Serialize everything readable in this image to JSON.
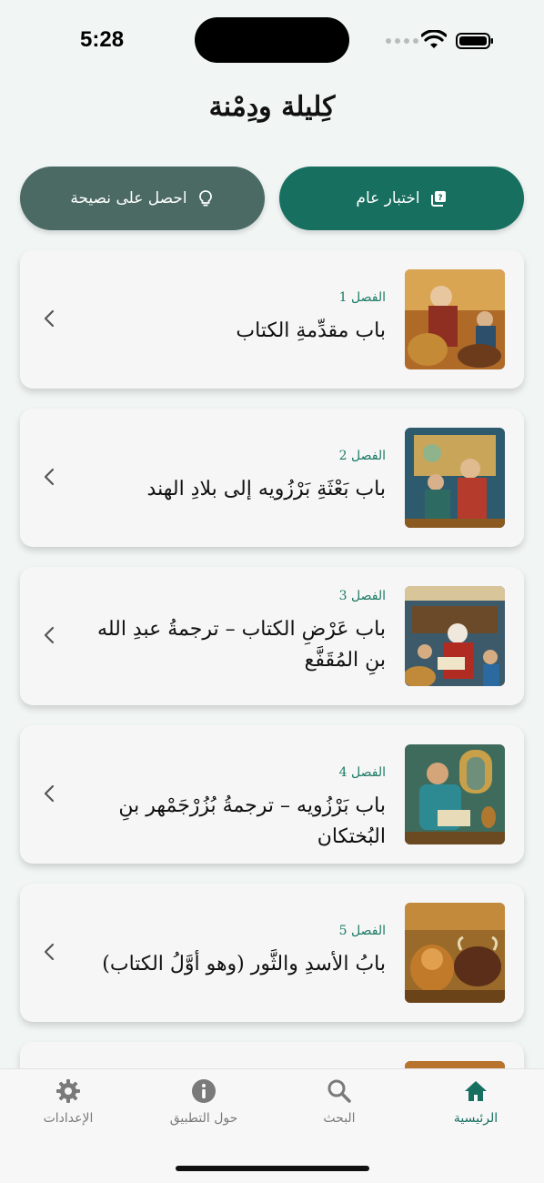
{
  "status_bar": {
    "time": "5:28"
  },
  "app": {
    "title": "كِليلة ودِمْنة"
  },
  "actions": {
    "quiz_label": "اختبار عام",
    "tip_label": "احصل على نصيحة"
  },
  "chapters": [
    {
      "number_label": "الفصل 1",
      "title": "باب مقدِّمةِ الكتاب"
    },
    {
      "number_label": "الفصل 2",
      "title": "باب بَعْثَةِ بَرْزُويه إلى بلادِ الهند"
    },
    {
      "number_label": "الفصل 3",
      "title": "باب عَرْضِ الكتاب – ترجمةُ عبدِ الله بنِ المُقَفَّع"
    },
    {
      "number_label": "الفصل 4",
      "title": "باب بَرْزُويه – ترجمةُ بُزُرْجَمْهر بنِ البُختكان"
    },
    {
      "number_label": "الفصل 5",
      "title": "بابُ الأسدِ والثَّور (وهو أوَّلُ الكتاب)"
    }
  ],
  "tabs": {
    "home": "الرئيسية",
    "search": "البحث",
    "about": "حول التطبيق",
    "settings": "الإعدادات"
  },
  "colors": {
    "accent": "#176f60",
    "secondary_button": "#4b6a63",
    "background": "#f1f6f5"
  }
}
